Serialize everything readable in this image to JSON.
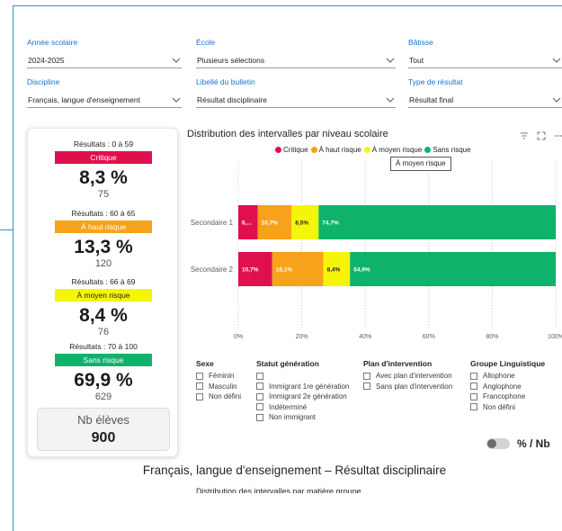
{
  "filters": [
    {
      "label": "Année scolaire",
      "value": "2024-2025"
    },
    {
      "label": "École",
      "value": "Plusieurs sélections"
    },
    {
      "label": "Bâtisse",
      "value": "Tout"
    },
    {
      "label": "Discipline",
      "value": "Français, langue d'enseignement"
    },
    {
      "label": "Libellé du bulletin",
      "value": "Résultat disciplinaire"
    },
    {
      "label": "Type de résultat",
      "value": "Résultat final"
    }
  ],
  "kpis": [
    {
      "range": "Résultats : 0 à 59",
      "badge": "Critique",
      "pct": "8,3 %",
      "count": "75",
      "color": "#e0104e",
      "text_color": "#ffffff"
    },
    {
      "range": "Résultats : 60 à 65",
      "badge": "À haut risque",
      "pct": "13,3 %",
      "count": "120",
      "color": "#f7a21b",
      "text_color": "#ffffff"
    },
    {
      "range": "Résultats : 66 à 69",
      "badge": "À moyen risque",
      "pct": "8,4 %",
      "count": "76",
      "color": "#f5f50a",
      "text_color": "#252423"
    },
    {
      "range": "Résultats : 70 à 100",
      "badge": "Sans risque",
      "pct": "69,9 %",
      "count": "629",
      "color": "#0fb26b",
      "text_color": "#ffffff"
    }
  ],
  "nb_eleves": {
    "label": "Nb élèves",
    "value": "900"
  },
  "chart": {
    "title": "Distribution des intervalles par niveau scolaire",
    "tooltip": "À moyen risque",
    "legend": [
      {
        "label": "Critique",
        "color": "#e0104e"
      },
      {
        "label": "À haut risque",
        "color": "#f7a21b"
      },
      {
        "label": "À moyen risque",
        "color": "#f5f50a"
      },
      {
        "label": "Sans risque",
        "color": "#0fb26b"
      }
    ]
  },
  "chart_data": {
    "type": "bar",
    "orientation": "horizontal",
    "stacked": true,
    "categories": [
      "Secondaire 1",
      "Secondaire 2"
    ],
    "series": [
      {
        "name": "Critique",
        "color": "#e0104e",
        "values": [
          6.1,
          10.7
        ],
        "labels": [
          "6,...",
          "10,7%"
        ]
      },
      {
        "name": "À haut risque",
        "color": "#f7a21b",
        "values": [
          10.7,
          16.1
        ],
        "labels": [
          "10,7%",
          "16,1%"
        ]
      },
      {
        "name": "À moyen risque",
        "color": "#f5f50a",
        "values": [
          8.5,
          8.4
        ],
        "labels": [
          "8,5%",
          "8,4%"
        ]
      },
      {
        "name": "Sans risque",
        "color": "#0fb26b",
        "values": [
          74.7,
          64.9
        ],
        "labels": [
          "74,7%",
          "64,9%"
        ]
      }
    ],
    "x_ticks": [
      "0%",
      "20%",
      "40%",
      "60%",
      "80%",
      "100%"
    ],
    "xlim": [
      0,
      100
    ],
    "grid": true,
    "legend_position": "top"
  },
  "slicers": [
    {
      "title": "Sexe",
      "items": [
        "Féminin",
        "Masculin",
        "Non défini"
      ]
    },
    {
      "title": "Statut génération",
      "items": [
        "",
        "Immigrant 1re génération",
        "Immigrant 2e génération",
        "Indéterminé",
        "Non immigrant"
      ]
    },
    {
      "title": "Plan d'intervention",
      "items": [
        "Avec plan d'intervention",
        "Sans plan d'intervention"
      ]
    },
    {
      "title": "Groupe Linguistique",
      "items": [
        "Allophone",
        "Anglophone",
        "Francophone",
        "Non défini"
      ]
    }
  ],
  "toggle": {
    "label": "% / Nb"
  },
  "bottom": {
    "title": "Français, langue d'enseignement – Résultat disciplinaire",
    "subtitle": "Distribution des intervalles par matière groupe"
  }
}
